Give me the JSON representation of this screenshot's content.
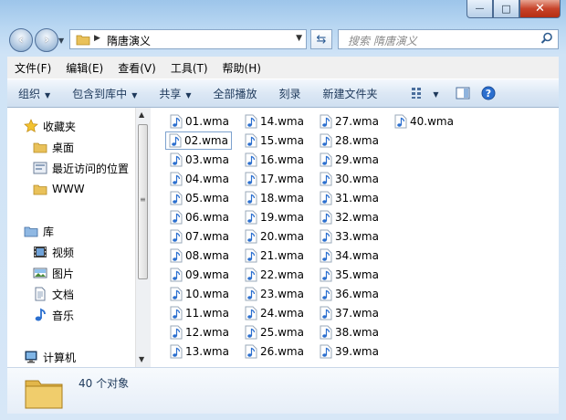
{
  "window": {
    "caption": {
      "minimize_glyph": "—",
      "maximize_glyph": "□",
      "close_glyph": "✕"
    }
  },
  "address": {
    "path": "隋唐演义",
    "search_placeholder": "搜索 隋唐演义"
  },
  "menu": [
    "文件(F)",
    "编辑(E)",
    "查看(V)",
    "工具(T)",
    "帮助(H)"
  ],
  "toolbar": {
    "organize": "组织",
    "include_in_library": "包含到库中",
    "share": "共享",
    "play_all": "全部播放",
    "burn": "刻录",
    "new_folder": "新建文件夹"
  },
  "nav": {
    "favorites": "收藏夹",
    "desktop": "桌面",
    "recent": "最近访问的位置",
    "www": "WWW",
    "libraries": "库",
    "videos": "视频",
    "pictures": "图片",
    "documents": "文档",
    "music": "音乐",
    "computer": "计算机"
  },
  "files": [
    "01.wma",
    "02.wma",
    "03.wma",
    "04.wma",
    "05.wma",
    "06.wma",
    "07.wma",
    "08.wma",
    "09.wma",
    "10.wma",
    "11.wma",
    "12.wma",
    "13.wma",
    "14.wma",
    "15.wma",
    "16.wma",
    "17.wma",
    "18.wma",
    "19.wma",
    "20.wma",
    "21.wma",
    "22.wma",
    "23.wma",
    "24.wma",
    "25.wma",
    "26.wma",
    "27.wma",
    "28.wma",
    "29.wma",
    "30.wma",
    "31.wma",
    "32.wma",
    "33.wma",
    "34.wma",
    "35.wma",
    "36.wma",
    "37.wma",
    "38.wma",
    "39.wma",
    "40.wma"
  ],
  "focused_file": "02.wma",
  "status": {
    "count_text": "40 个对象"
  },
  "colors": {
    "accent": "#1e395b",
    "window_frame": "#b9d7f2",
    "folder": "#e9c15a",
    "audio_icon": "#2b6fcf"
  }
}
